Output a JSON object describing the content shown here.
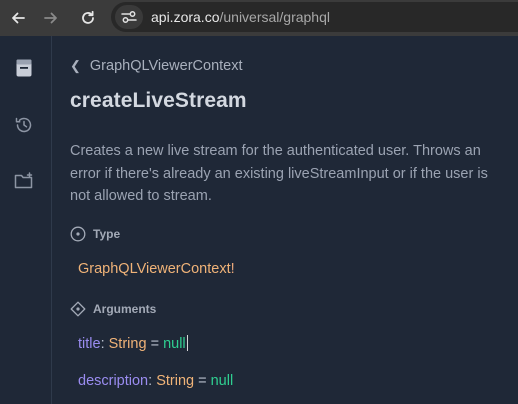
{
  "browser": {
    "url_host": "api.zora.co",
    "url_path": "/universal/graphql"
  },
  "doc": {
    "breadcrumb": "GraphQLViewerContext",
    "title": "createLiveStream",
    "description": "Creates a new live stream for the authenticated user. Throws an error if there's already an existing liveStreamInput or if the user is not allowed to stream.",
    "type_section": {
      "label": "Type",
      "type_name": "GraphQLViewerContext",
      "modifier": "!"
    },
    "arguments_section": {
      "label": "Arguments",
      "args": [
        {
          "name": "title",
          "colon": ":",
          "type": "String",
          "equals": "=",
          "default": "null"
        },
        {
          "name": "description",
          "colon": ":",
          "type": "String",
          "equals": "=",
          "default": "null"
        }
      ]
    }
  },
  "colors": {
    "background": "#1f2837",
    "type": "#f0b378",
    "argument": "#9a8cf0",
    "default_value": "#2fcf91"
  },
  "icons": {
    "nav": [
      "back-arrow-icon",
      "forward-arrow-icon",
      "reload-icon",
      "site-info-icon"
    ],
    "rail": [
      "docs-book-icon",
      "history-icon",
      "folder-add-icon"
    ]
  }
}
